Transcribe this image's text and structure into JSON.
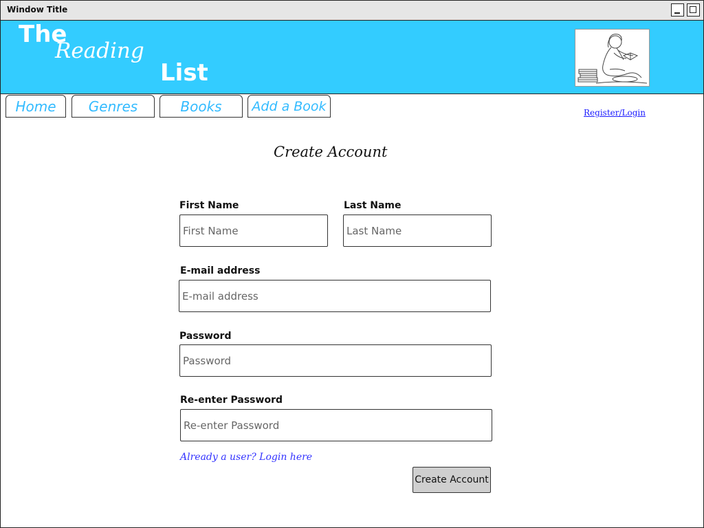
{
  "window": {
    "title": "Window Title"
  },
  "header": {
    "logo_line1": "The",
    "logo_line2": "Reading",
    "logo_line3": "List",
    "background_color": "#33ccff"
  },
  "nav": {
    "tabs": [
      {
        "label": "Home"
      },
      {
        "label": "Genres"
      },
      {
        "label": "Books"
      },
      {
        "label": "Add a Book"
      }
    ],
    "register_login": "Register/Login"
  },
  "form": {
    "title": "Create Account",
    "first_name": {
      "label": "First Name",
      "placeholder": "First Name"
    },
    "last_name": {
      "label": "Last Name",
      "placeholder": "Last Name"
    },
    "email": {
      "label": "E-mail address",
      "placeholder": "E-mail address"
    },
    "password": {
      "label": "Password",
      "placeholder": "Password"
    },
    "reenter_password": {
      "label": "Re-enter Password",
      "placeholder": "Re-enter Password"
    },
    "login_link": "Already a user? Login here",
    "submit_label": "Create Account"
  }
}
